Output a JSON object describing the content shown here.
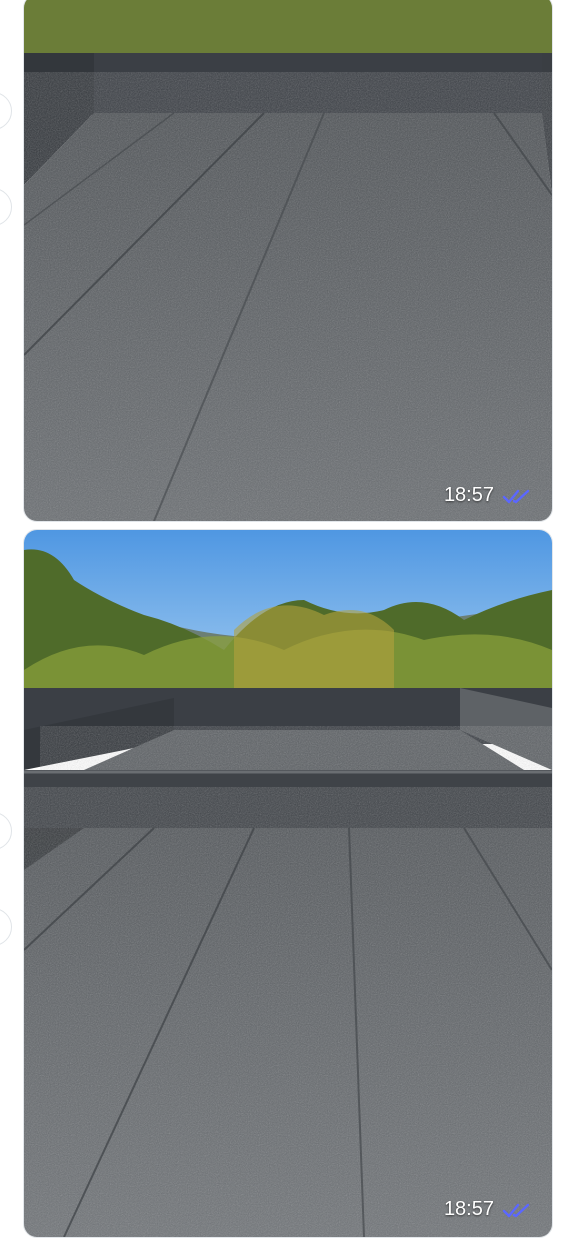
{
  "messages": [
    {
      "time": "18:57",
      "status_icon": "double-check-icon",
      "media": "photo"
    },
    {
      "time": "18:57",
      "status_icon": "double-check-icon",
      "media": "photo"
    }
  ],
  "colors": {
    "tick": "#5b67ff",
    "sky": "#6fb0ec",
    "roof": "#5b5f63"
  }
}
